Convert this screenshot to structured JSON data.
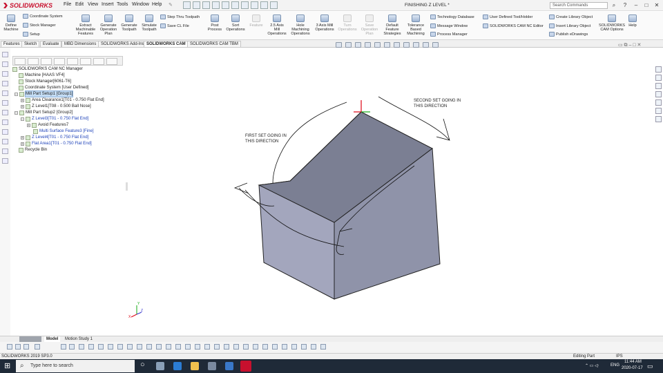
{
  "app": {
    "name": "SOLIDWORKS",
    "doc_title": "FINISHING Z LEVEL *",
    "search_placeholder": "Search Commands"
  },
  "menu": [
    "File",
    "Edit",
    "View",
    "Insert",
    "Tools",
    "Window",
    "Help"
  ],
  "ribbon": {
    "big": [
      {
        "label": "Define\nMachine"
      },
      {
        "label": "Extract\nMachinable\nFeatures"
      },
      {
        "label": "Generate\nOperation\nPlan"
      },
      {
        "label": "Generate\nToolpath"
      },
      {
        "label": "Simulate\nToolpath"
      },
      {
        "label": "Post\nProcess"
      },
      {
        "label": "Sort\nOperations"
      },
      {
        "label": "Feature",
        "disabled": true
      },
      {
        "label": "2.5 Axis\nMill\nOperations"
      },
      {
        "label": "Hole\nMachining\nOperations"
      },
      {
        "label": "3 Axis Mill\nOperations"
      },
      {
        "label": "Turn\nOperations",
        "disabled": true
      },
      {
        "label": "Save\nOperation\nPlan",
        "disabled": true
      },
      {
        "label": "Default\nFeature\nStrategies"
      },
      {
        "label": "Tolerance\nBased\nMachining"
      },
      {
        "label": "SOLIDWORKS\nCAM Options"
      },
      {
        "label": "Help"
      }
    ],
    "small": [
      "Coordinate System",
      "Stock Manager",
      "Setup",
      "Step Thru Toolpath",
      "Save CL File",
      "Technology Database",
      "Message Window",
      "Process Manager",
      "User Defined Tool/Holder",
      "SOLIDWORKS CAM NC Editor",
      "Create Library Object",
      "Insert Library Object",
      "Publish eDrawings"
    ]
  },
  "tabs": [
    "Features",
    "Sketch",
    "Evaluate",
    "MBD Dimensions",
    "SOLIDWORKS Add-Ins",
    "SOLIDWORKS CAM",
    "SOLIDWORKS CAM TBM"
  ],
  "active_tab": "SOLIDWORKS CAM",
  "tree": [
    {
      "label": "SOLIDWORKS CAM NC Manager"
    },
    {
      "label": "Machine [HAAS VF4]"
    },
    {
      "label": "Stock Manager[6061-T6]"
    },
    {
      "label": "Coordinate System [User Defined]"
    },
    {
      "label": "Mill Part Setup1 [Group1]",
      "selected": true
    },
    {
      "label": "Area Clearance1[T01 - 0.750 Flat End]"
    },
    {
      "label": "Z Level1[T08 - 0.500 Ball Nose]"
    },
    {
      "label": "Mill Part Setup2 [Group2]"
    },
    {
      "label": "Z Level3[T01 - 0.750 Flat End]"
    },
    {
      "label": "Avoid Features7"
    },
    {
      "label": "Multi Surface Feature3 [Fine]"
    },
    {
      "label": "Z Level4[T01 - 0.750 Flat End]"
    },
    {
      "label": "Flat Area1[T01 - 0.750 Flat End]"
    },
    {
      "label": "Recycle Bin"
    }
  ],
  "annotations": {
    "first": "FIRST SET GOING IN\nTHIS DIRECTION",
    "second": "SECOND SET GOING IN\nTHIS DIRECTION"
  },
  "triad": {
    "x": "X",
    "y": "Y",
    "z": "Z"
  },
  "bottom_tabs": [
    "Model",
    "Motion Study 1"
  ],
  "status": {
    "version": "SOLIDWORKS 2019 SP3.0",
    "mode": "Editing Part",
    "units": "IPS"
  },
  "taskbar": {
    "search_placeholder": "Type here to search",
    "lang": "ENG",
    "time": "11:44 AM",
    "date": "2020-07-17"
  },
  "colors": {
    "brand": "#c8102e",
    "model_top": "#7b7f93",
    "model_front": "#a3a6bd",
    "model_side": "#8f93a9",
    "taskbar": "#1f2a38"
  }
}
